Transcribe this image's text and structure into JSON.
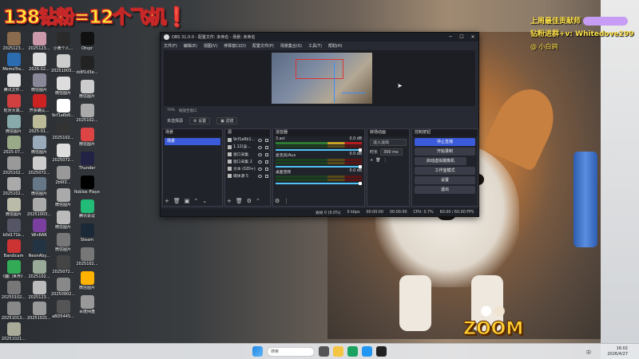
{
  "overlay": {
    "title": "138钻粉=12个飞机",
    "title_mark": "❗",
    "right_line1": "上周最佳贡献师",
    "right_line2": "钻粉进群+v: Whitedove299",
    "right_line3": "@ 小白鸽",
    "logo": "ZOOM"
  },
  "desktop_icons": [
    {
      "label": "2025123...",
      "color": "#8a6b4e"
    },
    {
      "label": "MemoTra...",
      "color": "#2b6cb0"
    },
    {
      "label": "腾讯文件...",
      "color": "#ddd"
    },
    {
      "label": "轮对大高...",
      "color": "#d04040"
    },
    {
      "label": "微信图片",
      "color": "#8aa"
    },
    {
      "label": "2025-07...",
      "color": "#9a8"
    },
    {
      "label": "2025102...",
      "color": "#999"
    },
    {
      "label": "2025102...",
      "color": "#aaa"
    },
    {
      "label": "微信图片",
      "color": "#bba"
    },
    {
      "label": "b0d171b...",
      "color": "#556"
    },
    {
      "label": "Bandicam",
      "color": "#c33"
    },
    {
      "label": "《魔门世界》...",
      "color": "#3a5"
    },
    {
      "label": "20250102...",
      "color": "#777"
    },
    {
      "label": "20251013...",
      "color": "#888"
    },
    {
      "label": "20251021...",
      "color": "#aa9"
    }
  ],
  "desktop_icons_col2": [
    {
      "label": "2025123...",
      "color": "#c9a"
    },
    {
      "label": "2026-02...",
      "color": "#ddd"
    },
    {
      "label": "微信图片",
      "color": "#889"
    },
    {
      "label": "开票确认...",
      "color": "#c22"
    },
    {
      "label": "2025-01...",
      "color": "#bb9"
    },
    {
      "label": "微信图片",
      "color": "#9ab"
    },
    {
      "label": "2025072...",
      "color": "#ccc"
    },
    {
      "label": "微信图片",
      "color": "#678"
    },
    {
      "label": "20251003...",
      "color": "#aaa"
    },
    {
      "label": "WinRAR",
      "color": "#7b3fa0"
    },
    {
      "label": "NeonAby...",
      "color": "#234"
    },
    {
      "label": "2025102...",
      "color": "#9a9"
    },
    {
      "label": "2025123...",
      "color": "#bbb"
    },
    {
      "label": "20251021...",
      "color": "#999"
    }
  ],
  "desktop_icons_col3": [
    {
      "label": "小黄个人...",
      "color": "#2a2a2a"
    },
    {
      "label": "20251003...",
      "color": "#ccc"
    },
    {
      "label": "微信图片",
      "color": "#ddd"
    },
    {
      "label": "9cf1a6b6...",
      "color": "#fff"
    },
    {
      "label": "2025102...",
      "color": "#333"
    },
    {
      "label": "2025072...",
      "color": "#ddd"
    },
    {
      "label": "2b6f2...",
      "color": "#999"
    },
    {
      "label": "微信图片",
      "color": "#aaa"
    },
    {
      "label": "微信图片",
      "color": "#bbb"
    },
    {
      "label": "微信图片",
      "color": "#777"
    },
    {
      "label": "2025072...",
      "color": "#444"
    },
    {
      "label": "20250902...",
      "color": "#888"
    },
    {
      "label": "aBD5445...",
      "color": "#555"
    }
  ],
  "desktop_icons_col4": [
    {
      "label": "Otspr",
      "color": "#111"
    },
    {
      "label": "ddlf1d3e...",
      "color": "#222"
    },
    {
      "label": "微信图片",
      "color": "#ccc"
    },
    {
      "label": "2025102...",
      "color": "#aaa"
    },
    {
      "label": "微信图片",
      "color": "#d44"
    },
    {
      "label": "Thunder",
      "color": "#224"
    },
    {
      "label": "Roblox Player",
      "color": "#000"
    },
    {
      "label": "腾讯会议",
      "color": "#2b7"
    },
    {
      "label": "Steam",
      "color": "#1b2838"
    },
    {
      "label": "2025102...",
      "color": "#777"
    },
    {
      "label": "微信图片",
      "color": "#ffb300"
    },
    {
      "label": "百度网盘",
      "color": "#999"
    }
  ],
  "obs": {
    "window_title": "OBS 31.0.0 - 配置文件: 未命名 - 场景: 未命名",
    "menu": [
      "文件(F)",
      "编辑(E)",
      "视图(V)",
      "停靠窗口(D)",
      "配置文件(P)",
      "场景集合(S)",
      "工具(T)",
      "帮助(H)"
    ],
    "sub_bar": [
      "70%",
      "缩放至窗口"
    ],
    "no_source": "未选择源",
    "props_btn": "⚙ 设置",
    "filter_btn": "▣ 滤镜",
    "docks": {
      "scenes_title": "场景",
      "sources_title": "源",
      "mixer_title": "混音器",
      "transitions_title": "转场动画",
      "controls_title": "控制按钮"
    },
    "scene_items": [
      "场景"
    ],
    "source_items": [
      "9cf1a6b1...",
      "1.12(@...",
      "窗口采集",
      "窗口采集 2",
      "文本 (GDI+)",
      "媒体源 5"
    ],
    "mixer_tracks": [
      {
        "name": "3.avi",
        "db": "0.0 dB"
      },
      {
        "name": "麦克风/Aux",
        "db": "0.0 dB"
      },
      {
        "name": "桌面音频",
        "db": "0.0 dB"
      }
    ],
    "transition": {
      "type": "淡入淡出",
      "duration_label": "时长",
      "duration": "300 ms"
    },
    "controls": [
      "停止直播",
      "开始录制",
      "启动虚拟摄像机",
      "工作室模式",
      "设置",
      "退出"
    ],
    "status": [
      "丢帧 0 (0.0%)",
      "0 kbps",
      "00:00:00",
      "00:00:00",
      "CPU: 0.7%",
      "60.00 / 60.00 FPS"
    ]
  },
  "taskbar": {
    "search": "搜索",
    "time": "16:02",
    "date": "2026/4/27",
    "tray": "中"
  }
}
